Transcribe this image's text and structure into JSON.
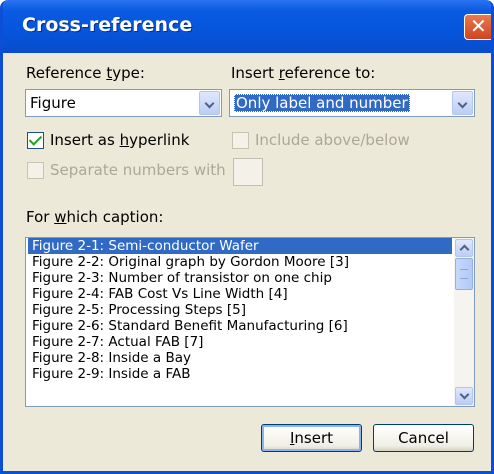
{
  "window": {
    "title": "Cross-reference",
    "close_symbol": "✕"
  },
  "reference_type": {
    "label_pre": "Reference ",
    "label_key": "t",
    "label_post": "ype:",
    "value": "Figure"
  },
  "insert_reference_to": {
    "label_pre": "Insert ",
    "label_key": "r",
    "label_post": "eference to:",
    "value": "Only label and number"
  },
  "insert_as_hyperlink": {
    "label_pre": "Insert as ",
    "label_key": "h",
    "label_post": "yperlink",
    "checked": true
  },
  "include_above_below": {
    "label": "Include above/below",
    "enabled": false
  },
  "separate_numbers": {
    "label": "Separate numbers with",
    "enabled": false
  },
  "caption": {
    "label_pre": "For ",
    "label_key": "w",
    "label_post": "hich caption:",
    "items": [
      "Figure 2-1: Semi-conductor Wafer",
      "Figure 2-2: Original graph by Gordon Moore [3]",
      "Figure 2-3: Number of transistor on one chip",
      "Figure 2-4: FAB Cost Vs Line Width [4]",
      "Figure 2-5: Processing Steps [5]",
      "Figure 2-6: Standard Benefit Manufacturing [6]",
      "Figure 2-7: Actual FAB [7]",
      "Figure 2-8: Inside a Bay",
      "Figure 2-9: Inside a FAB"
    ],
    "selected_index": 0
  },
  "buttons": {
    "insert_key": "I",
    "insert_rest": "nsert",
    "cancel": "Cancel"
  },
  "icons": [
    "close-icon",
    "chevron-down-icon",
    "check-icon",
    "chevron-up-icon"
  ]
}
